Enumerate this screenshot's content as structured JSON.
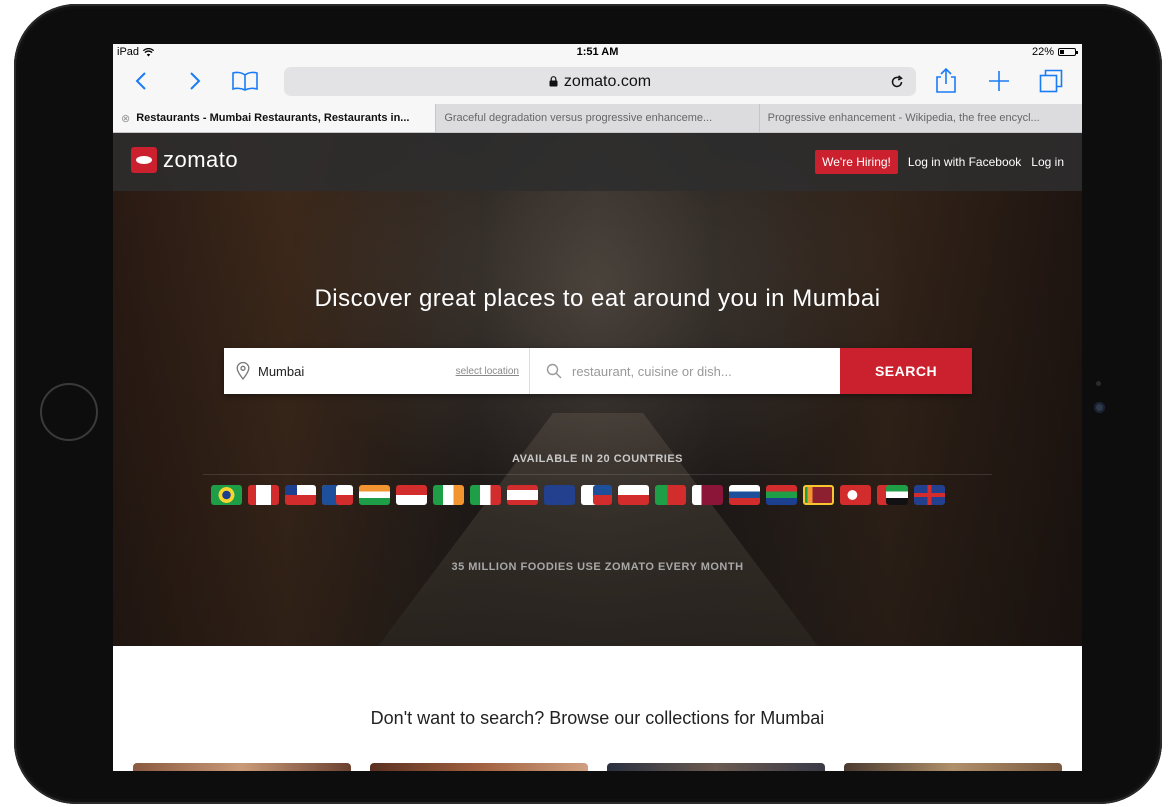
{
  "status_bar": {
    "device": "iPad",
    "time": "1:51 AM",
    "battery": "22%",
    "battery_fill": 0.22
  },
  "browser": {
    "url": "zomato.com",
    "icons": [
      "back-icon",
      "forward-icon",
      "bookmarks-icon",
      "reload-icon",
      "share-icon",
      "new-tab-icon",
      "tabs-icon"
    ],
    "tabs": [
      {
        "label": "Restaurants - Mumbai Restaurants, Restaurants in...",
        "active": true
      },
      {
        "label": "Graceful degradation versus progressive enhanceme...",
        "active": false
      },
      {
        "label": "Progressive enhancement - Wikipedia, the free encycl...",
        "active": false
      }
    ]
  },
  "site": {
    "logo": "zomato",
    "nav": {
      "hiring": "We're Hiring!",
      "facebook": "Log in with Facebook",
      "login": "Log in"
    },
    "headline": "Discover great places to eat around you in Mumbai",
    "search": {
      "location_value": "Mumbai",
      "select_location": "select location",
      "placeholder": "restaurant, cuisine or dish...",
      "button": "SEARCH"
    },
    "available": "AVAILABLE IN 20 COUNTRIES",
    "foodies": "35 MILLION FOODIES USE ZOMATO EVERY MONTH",
    "browse": "Don't want to search? Browse our collections for Mumbai"
  },
  "colors": {
    "brand_red": "#cb202d",
    "ios_blue": "#1a7cf5"
  }
}
